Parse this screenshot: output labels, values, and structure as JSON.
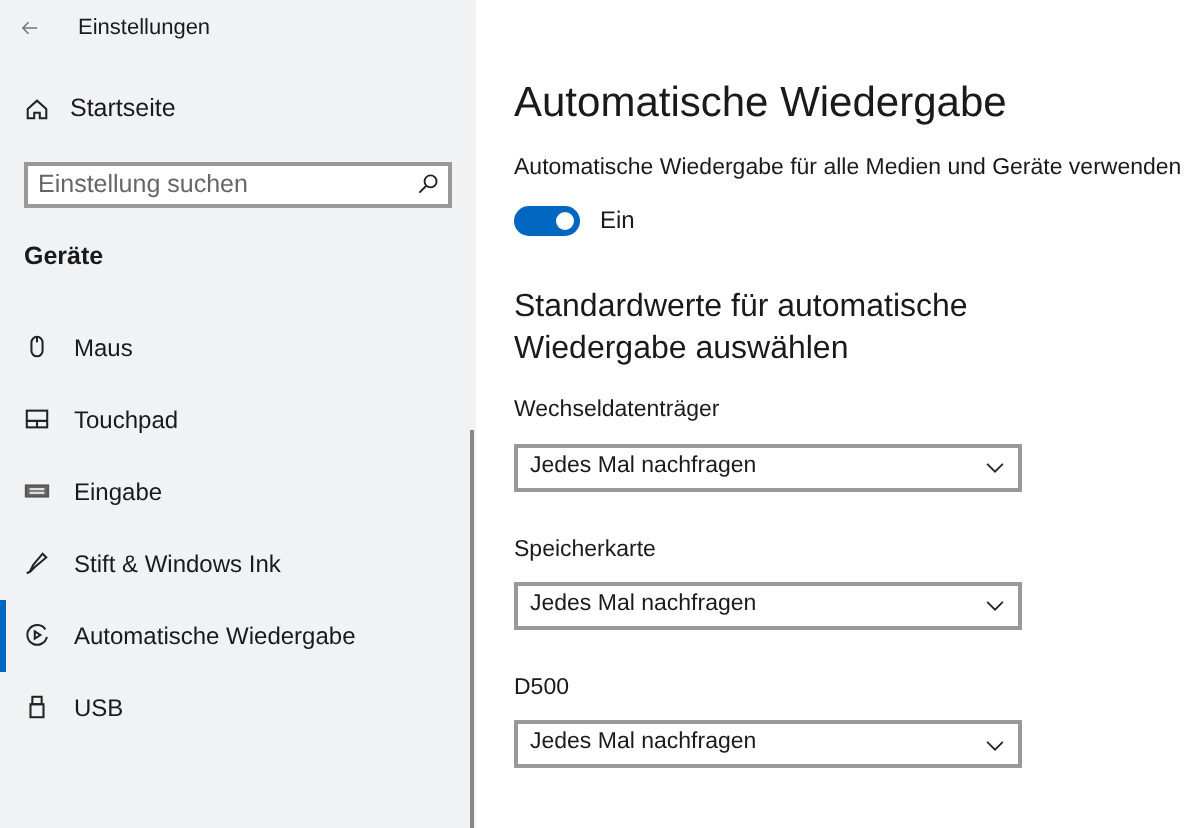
{
  "window": {
    "title": "Einstellungen"
  },
  "sidebar": {
    "home": "Startseite",
    "search": {
      "placeholder": "Einstellung suchen"
    },
    "section": "Geräte",
    "items": [
      {
        "label": "Maus",
        "kind": "mouse",
        "selected": false
      },
      {
        "label": "Touchpad",
        "kind": "touchpad",
        "selected": false
      },
      {
        "label": "Eingabe",
        "kind": "keyboard",
        "selected": false
      },
      {
        "label": "Stift & Windows Ink",
        "kind": "pen",
        "selected": false
      },
      {
        "label": "Automatische Wiedergabe",
        "kind": "autoplay",
        "selected": true
      },
      {
        "label": "USB",
        "kind": "usb",
        "selected": false
      }
    ]
  },
  "main": {
    "title": "Automatische Wiedergabe",
    "toggle": {
      "label": "Automatische Wiedergabe für alle Medien und Geräte verwenden",
      "on": true,
      "state": "Ein"
    },
    "section": "Standardwerte für automatische Wiedergabe auswählen",
    "dropdowns": [
      {
        "label": "Wechseldatenträger",
        "value": "Jedes Mal nachfragen"
      },
      {
        "label": "Speicherkarte",
        "value": "Jedes Mal nachfragen"
      },
      {
        "label": "D500",
        "value": "Jedes Mal nachfragen"
      }
    ]
  }
}
